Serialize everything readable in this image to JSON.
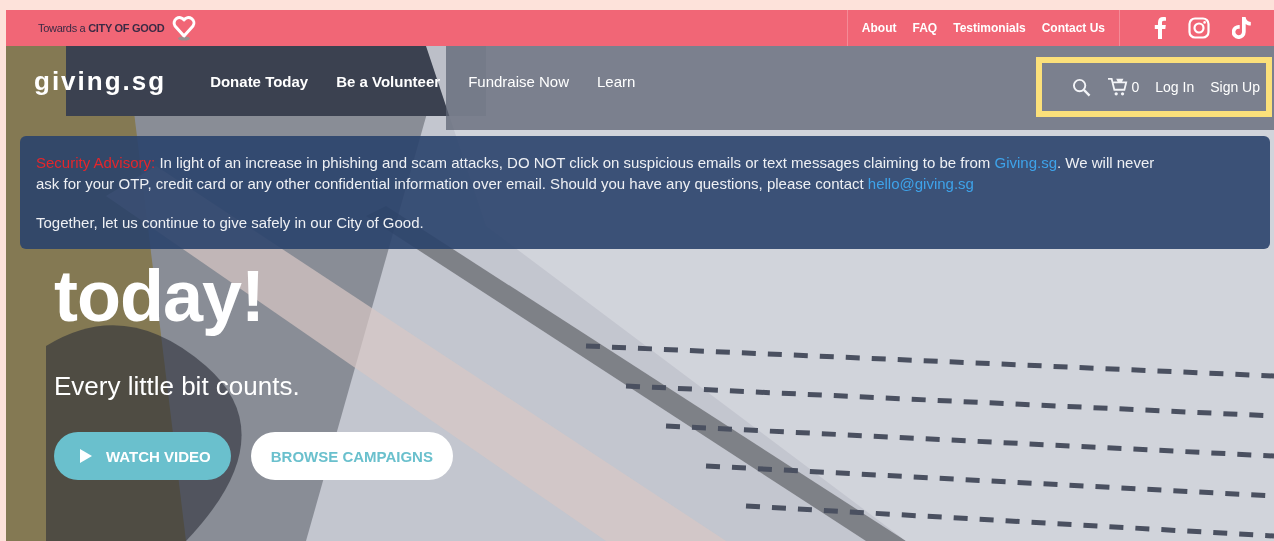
{
  "top_bar": {
    "tagline": {
      "lead": "Towards a",
      "name": "CITY OF GOOD"
    },
    "links": [
      {
        "label": "About"
      },
      {
        "label": "FAQ"
      },
      {
        "label": "Testimonials"
      },
      {
        "label": "Contact Us"
      }
    ],
    "social": [
      {
        "kind": "facebook"
      },
      {
        "kind": "instagram"
      },
      {
        "kind": "tiktok"
      }
    ]
  },
  "nav": {
    "logo": "giving.sg",
    "items": [
      {
        "label": "Donate Today",
        "dim": false
      },
      {
        "label": "Be a Volunteer",
        "dim": false
      },
      {
        "label": "Fundraise Now",
        "dim": true
      },
      {
        "label": "Learn",
        "dim": true
      }
    ],
    "cart_count": "0",
    "login": "Log In",
    "signup": "Sign Up",
    "highlighted": true
  },
  "advisory": {
    "paragraphs": [
      [
        {
          "kind": "label",
          "text": "Security Advisory:"
        },
        {
          "kind": "text",
          "text": " In light of an increase in phishing and scam attacks, DO NOT click on suspicious emails or text messages claiming to be from "
        },
        {
          "kind": "link",
          "text": "Giving.sg"
        },
        {
          "kind": "text",
          "text": ". We will never ask for your OTP, credit card or any other confidential information over email. Should you have any questions, please contact "
        },
        {
          "kind": "link",
          "text": "hello@giving.sg"
        }
      ],
      [
        {
          "kind": "text",
          "text": "Together, let us continue to give safely in our City of Good."
        }
      ]
    ]
  },
  "hero": {
    "heading_lines": [
      "today!"
    ],
    "subtitle": "Every little bit counts.",
    "buttons": [
      {
        "label": "WATCH VIDEO",
        "kind": "primary"
      },
      {
        "label": "BROWSE CAMPAIGNS",
        "kind": "secondary"
      }
    ]
  }
}
